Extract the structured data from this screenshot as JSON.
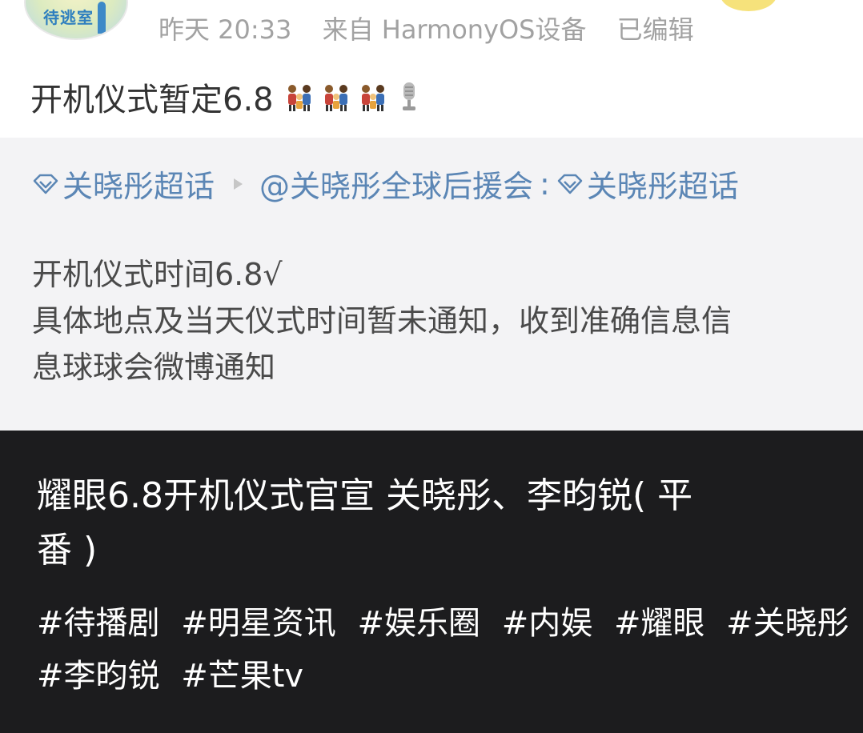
{
  "post": {
    "avatar_text": "待逃室",
    "timestamp": "昨天 20:33",
    "source": "来自 HarmonyOS设备",
    "edited": "已编辑",
    "title": "开机仪式暂定6.8"
  },
  "repost": {
    "topic_label": "关晓彤超话",
    "mention": "@关晓彤全球后援会",
    "colon": ":",
    "topic_label_2": "关晓彤超话",
    "lines": [
      "开机仪式时间6.8√",
      "具体地点及当天仪式时间暂未通知，收到准确信息信",
      "息球球会微博通知"
    ]
  },
  "caption": {
    "headline_lines": [
      "耀眼6.8开机仪式官宣 关晓彤、李昀锐( 平",
      "番 )"
    ],
    "tags": [
      "#待播剧",
      "#明星资讯",
      "#娱乐圈",
      "#内娱",
      "#耀眼",
      "#关晓彤",
      "#李昀锐",
      "#芒果tv"
    ]
  },
  "colors": {
    "topic_blue": "#5b86b5",
    "meta_gray": "#a2a2a2",
    "dark_bg": "#1c1c1e"
  }
}
